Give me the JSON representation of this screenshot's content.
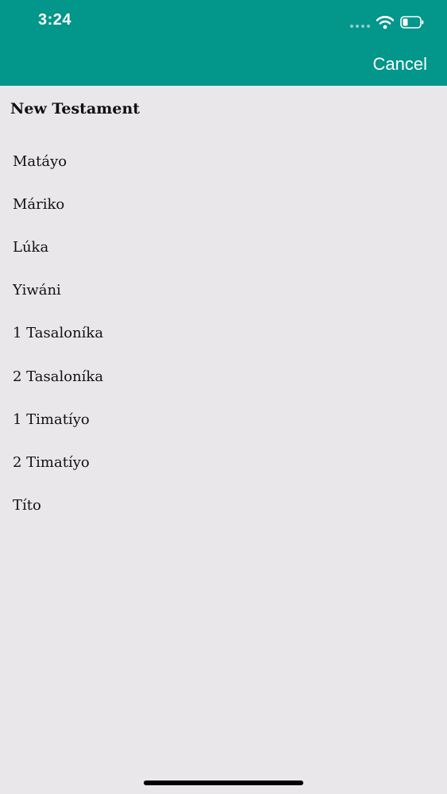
{
  "status_bar": {
    "time": "3:24",
    "icons": [
      "signal-dots-icon",
      "wifi-icon",
      "battery-icon"
    ]
  },
  "header": {
    "cancel_label": "Cancel",
    "background_color": "#03968a"
  },
  "section": {
    "title": "New Testament"
  },
  "books": [
    {
      "label": "Matáyo"
    },
    {
      "label": "Máriko"
    },
    {
      "label": "Lúka"
    },
    {
      "label": "Yiwáni"
    },
    {
      "label": "1 Tasaloníka"
    },
    {
      "label": "2 Tasaloníka"
    },
    {
      "label": "1 Timatíyo"
    },
    {
      "label": "2 Timatíyo"
    },
    {
      "label": "Títo"
    }
  ]
}
